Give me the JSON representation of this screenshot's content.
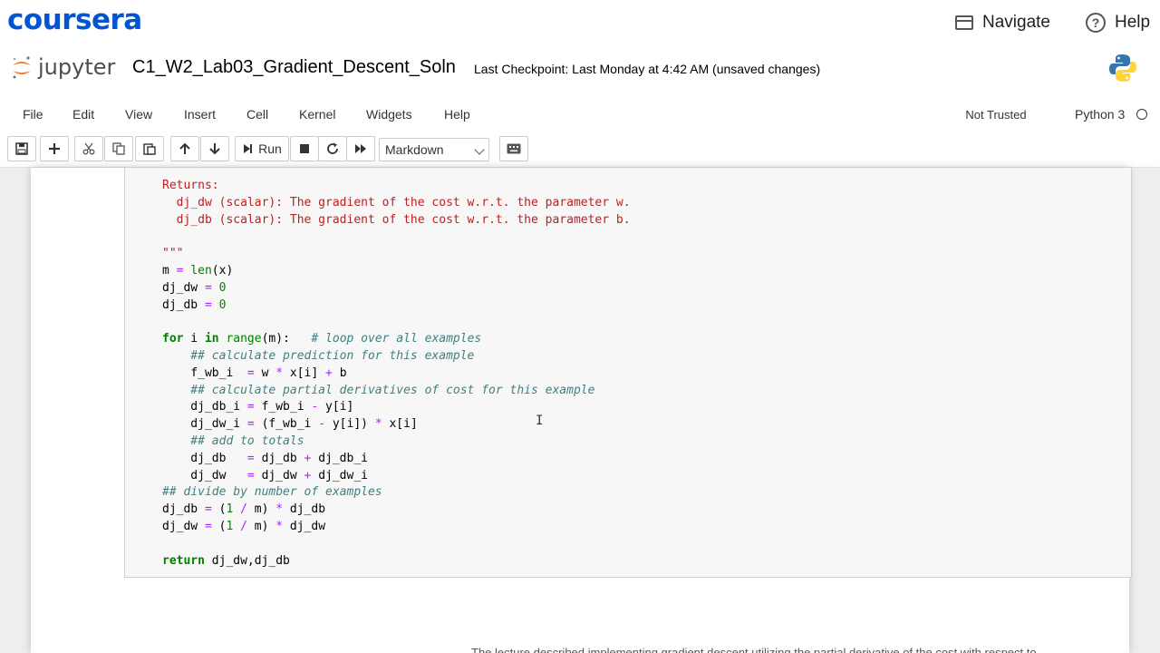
{
  "coursera": {
    "logo": "coursera",
    "navigate": "Navigate",
    "help": "Help",
    "help_glyph": "?"
  },
  "jupyter": {
    "brand": "jupyter",
    "notebook_title": "C1_W2_Lab03_Gradient_Descent_Soln",
    "checkpoint": "Last Checkpoint: Last Monday at 4:42 AM  (unsaved changes)"
  },
  "menubar": {
    "items": [
      "File",
      "Edit",
      "View",
      "Insert",
      "Cell",
      "Kernel",
      "Widgets",
      "Help"
    ],
    "trust": "Not Trusted",
    "kernel": "Python 3"
  },
  "toolbar": {
    "run_label": "Run",
    "cell_type": "Markdown",
    "icons": [
      "save-icon",
      "plus-icon",
      "cut-icon",
      "copy-icon",
      "paste-icon",
      "arrow-up-icon",
      "arrow-down-icon",
      "run-icon",
      "stop-icon",
      "restart-icon",
      "fast-forward-icon",
      "keyboard-icon"
    ]
  },
  "cell": {
    "code_lines": [
      "Returns:",
      "  dj_dw (scalar): The gradient of the cost w.r.t. the parameter w.",
      "  dj_db (scalar): The gradient of the cost w.r.t. the parameter b.",
      "",
      "\"\"\"",
      "m = len(x)",
      "dj_dw = 0",
      "dj_db = 0",
      "",
      "for i in range(m):   # loop over all examples",
      "    ## calculate prediction for this example",
      "    f_wb_i  = w * x[i] + b",
      "    ## calculate partial derivatives of cost for this example",
      "    dj_db_i = f_wb_i - y[i]",
      "    dj_dw_i = (f_wb_i - y[i]) * x[i]",
      "    ## add to totals",
      "    dj_db   = dj_db + dj_db_i",
      "    dj_dw   = dj_dw + dj_dw_i",
      "## divide by number of examples",
      "dj_db = (1 / m) * dj_db",
      "dj_dw = (1 / m) * dj_dw",
      "",
      "return dj_dw,dj_db"
    ]
  },
  "next_cell_hint": "The lecture described implementing gradient descent utilizing the partial derivative of the cost with respect to"
}
